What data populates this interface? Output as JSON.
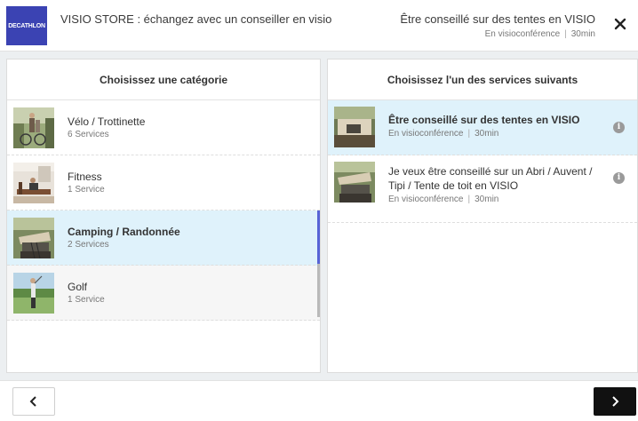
{
  "header": {
    "logo_text": "DECATHLON",
    "store_title": "VISIO STORE : échangez avec un conseiller en visio",
    "selected_service": "Être conseillé sur des tentes en VISIO",
    "selected_mode": "En visioconférence",
    "selected_duration": "30min",
    "close_icon": "close-icon"
  },
  "categories": {
    "heading": "Choisissez une catégorie",
    "items": [
      {
        "name": "Vélo / Trottinette",
        "count": "6 Services",
        "state": "normal"
      },
      {
        "name": "Fitness",
        "count": "1 Service",
        "state": "normal"
      },
      {
        "name": "Camping / Randonnée",
        "count": "2 Services",
        "state": "selected"
      },
      {
        "name": "Golf",
        "count": "1 Service",
        "state": "hover"
      }
    ]
  },
  "services": {
    "heading": "Choisissez l'un des services suivants",
    "items": [
      {
        "title": "Être conseillé sur des tentes en VISIO",
        "mode": "En visioconférence",
        "duration": "30min",
        "state": "selected"
      },
      {
        "title": "Je veux être conseillé sur un Abri / Auvent / Tipi / Tente de toit en VISIO",
        "mode": "En visioconférence",
        "duration": "30min",
        "state": "normal"
      }
    ]
  },
  "footer": {
    "prev_icon": "chevron-left-icon",
    "next_icon": "chevron-right-icon"
  },
  "colors": {
    "brand": "#3b43b3",
    "selected_bg": "#dff2fb",
    "selected_bar": "#5763d6",
    "next_button": "#111111"
  }
}
